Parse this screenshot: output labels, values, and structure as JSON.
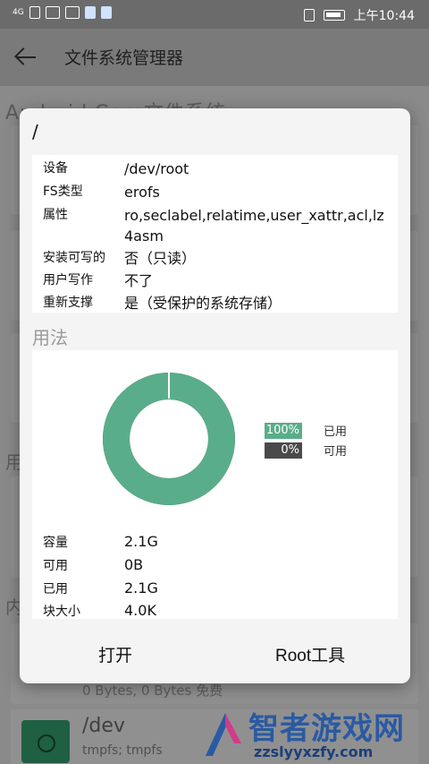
{
  "statusbar": {
    "network": "4G",
    "time": "上午10:44"
  },
  "appbar": {
    "title": "文件系统管理器"
  },
  "background": {
    "heading": "Android Core文件系统",
    "side_text_1": "用",
    "side_text_2": "内",
    "footer_text": "0 Bytes, 0 Bytes 免费",
    "dev_title": "/dev",
    "dev_sub": "tmpfs; tmpfs",
    "watermark_title": "智者游戏网",
    "watermark_url": "zzslyyxzfy.com"
  },
  "dialog": {
    "path": "/",
    "info": [
      {
        "key": "设备",
        "value": "/dev/root"
      },
      {
        "key": "FS类型",
        "value": "erofs"
      },
      {
        "key": "属性",
        "value": "ro,seclabel,relatime,user_xattr,acl,lz4asm"
      },
      {
        "key": "安装可写的",
        "value": "否（只读）"
      },
      {
        "key": "用户写作",
        "value": "不了"
      },
      {
        "key": "重新支撑",
        "value": "是（受保护的系统存储）"
      }
    ],
    "usage_title": "用法",
    "legend": [
      {
        "percent": "100%",
        "label": "已用",
        "color": "#5aad8a"
      },
      {
        "percent": "0%",
        "label": "可用",
        "color": "#4a4a4a"
      }
    ],
    "used_fraction": 1.0,
    "stats": [
      {
        "key": "容量",
        "value": "2.1G"
      },
      {
        "key": "可用",
        "value": "0B"
      },
      {
        "key": "已用",
        "value": "2.1G"
      },
      {
        "key": "块大小",
        "value": "4.0K"
      }
    ],
    "buttons": {
      "open": "打开",
      "root_tools": "Root工具"
    }
  }
}
